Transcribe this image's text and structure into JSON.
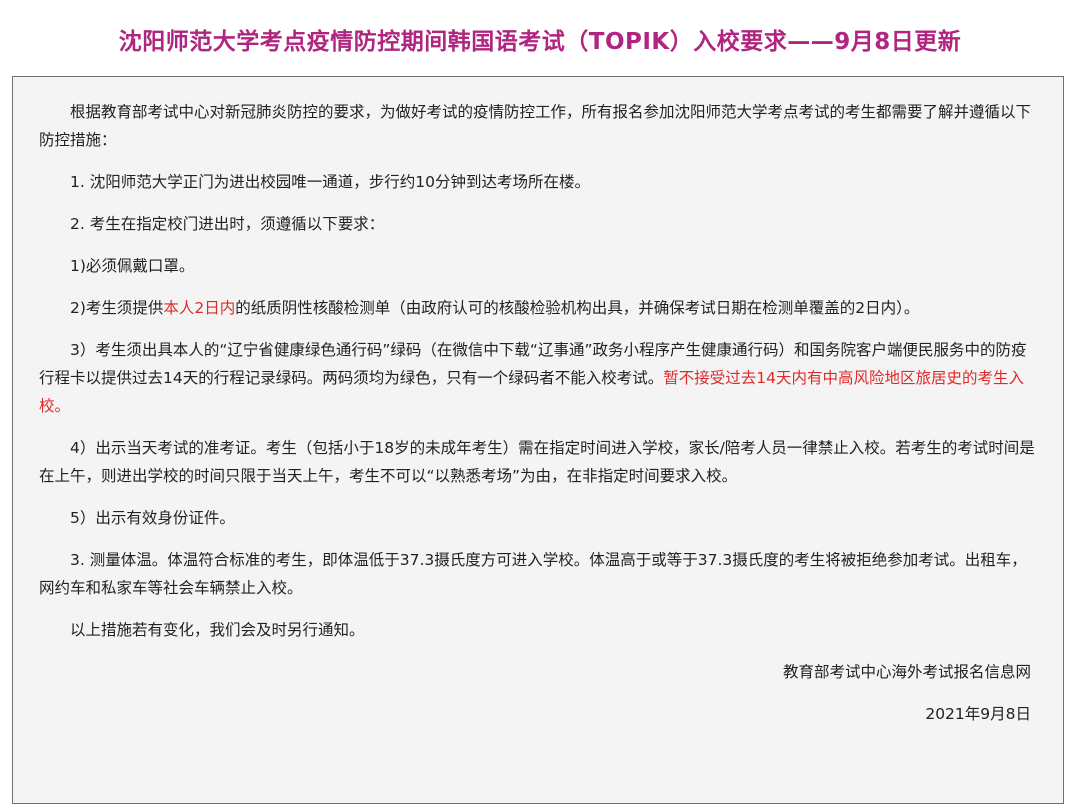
{
  "title": "沈阳师范大学考点疫情防控期间韩国语考试（TOPIK）入校要求——9月8日更新",
  "colors": {
    "title": "#b0257f",
    "highlight": "#e02a2a",
    "border": "#6f6f6f",
    "background": "#f4f4f4"
  },
  "notice": {
    "intro": "根据教育部考试中心对新冠肺炎防控的要求，为做好考试的疫情防控工作，所有报名参加沈阳师范大学考点考试的考生都需要了解并遵循以下防控措施：",
    "item1": "1. 沈阳师范大学正门为进出校园唯一通道，步行约10分钟到达考场所在楼。",
    "item2": "2. 考生在指定校门进出时，须遵循以下要求：",
    "sub1": "1)必须佩戴口罩。",
    "sub2": {
      "before": "2)考生须提供",
      "highlight": "本人2日内",
      "after": "的纸质阴性核酸检测单（由政府认可的核酸检验机构出具，并确保考试日期在检测单覆盖的2日内）。"
    },
    "sub3": {
      "before": "3）考生须出具本人的“辽宁省健康绿色通行码”绿码（在微信中下载“辽事通”政务小程序产生健康通行码）和国务院客户端便民服务中的防疫行程卡以提供过去14天的行程记录绿码。两码须均为绿色，只有一个绿码者不能入校考试。",
      "highlight": "暂不接受过去14天内有中高风险地区旅居史的考生入校。"
    },
    "sub4": "4）出示当天考试的准考证。考生（包括小于18岁的未成年考生）需在指定时间进入学校，家长/陪考人员一律禁止入校。若考生的考试时间是在上午，则进出学校的时间只限于当天上午，考生不可以“以熟悉考场”为由，在非指定时间要求入校。",
    "sub5": "5）出示有效身份证件。",
    "item3": "3. 测量体温。体温符合标准的考生，即体温低于37.3摄氏度方可进入学校。体温高于或等于37.3摄氏度的考生将被拒绝参加考试。出租车，网约车和私家车等社会车辆禁止入校。",
    "closing": "以上措施若有变化，我们会及时另行通知。",
    "signature": "教育部考试中心海外考试报名信息网",
    "date": "2021年9月8日"
  }
}
